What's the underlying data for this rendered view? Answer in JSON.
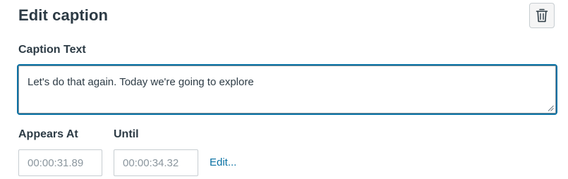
{
  "header": {
    "title": "Edit caption"
  },
  "actions": {
    "delete_icon": "trash-icon"
  },
  "caption": {
    "label": "Caption Text",
    "value": "Let's do that again. Today we're going to explore"
  },
  "timing": {
    "appears_at_label": "Appears At",
    "appears_at_value": "00:00:31.89",
    "until_label": "Until",
    "until_value": "00:00:34.32",
    "edit_label": "Edit..."
  },
  "colors": {
    "focus_border": "#0770a3",
    "link": "#0770a3",
    "text": "#2d3b45",
    "muted_text": "#8b969e"
  }
}
